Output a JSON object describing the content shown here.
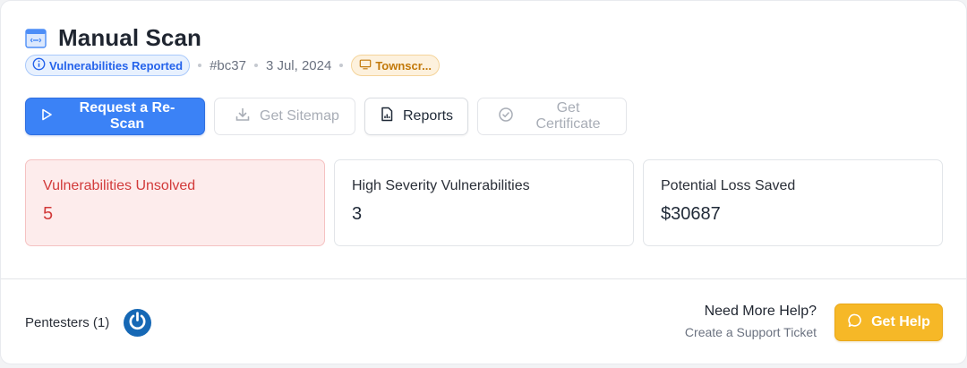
{
  "header": {
    "title": "Manual Scan",
    "status_badge": "Vulnerabilities Reported",
    "scan_id": "#bc37",
    "date": "3 Jul, 2024",
    "site_badge": "Townscr..."
  },
  "actions": {
    "rescan": "Request a Re-Scan",
    "sitemap": "Get Sitemap",
    "reports": "Reports",
    "certificate": "Get Certificate"
  },
  "stats": [
    {
      "label": "Vulnerabilities Unsolved",
      "value": "5"
    },
    {
      "label": "High Severity Vulnerabilities",
      "value": "3"
    },
    {
      "label": "Potential Loss Saved",
      "value": "$30687"
    }
  ],
  "footer": {
    "pentesters_label": "Pentesters (1)",
    "help_title": "Need More Help?",
    "help_sub": "Create a Support Ticket",
    "help_button": "Get Help"
  },
  "colors": {
    "primary": "#3b82f6",
    "danger": "#d23a3a",
    "warning": "#f6b827",
    "info_badge": "#2563eb",
    "site_badge": "#c2790a"
  },
  "icons": [
    "scan-icon",
    "info-icon",
    "monitor-icon",
    "play-icon",
    "download-icon",
    "report-icon",
    "check-circle-icon",
    "power-icon",
    "chat-icon"
  ]
}
